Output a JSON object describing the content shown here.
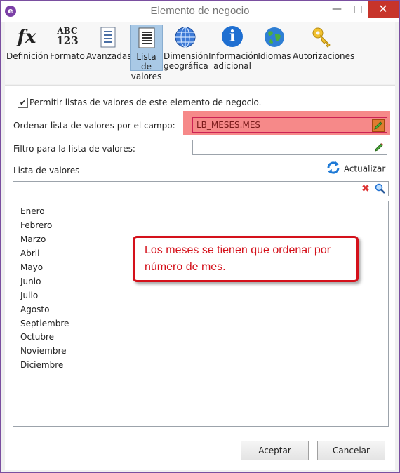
{
  "window": {
    "title": "Elemento de negocio",
    "minimize": "—",
    "maximize": "□",
    "close": "✕",
    "app_icon": "e"
  },
  "ribbon": {
    "items": [
      {
        "label": "Definición",
        "icon": "fx-icon",
        "glyph": "fx"
      },
      {
        "label": "Formato",
        "icon": "abc-123-icon",
        "glyph_top": "ABC",
        "glyph_bottom": "123"
      },
      {
        "label": "Avanzadas",
        "icon": "document-list-icon"
      },
      {
        "label_line1": "Lista de",
        "label_line2": "valores",
        "icon": "list-icon",
        "active": true
      },
      {
        "label_line1": "Dimensión",
        "label_line2": "geográfica",
        "icon": "globe-grid-icon"
      },
      {
        "label_line1": "Información",
        "label_line2": "adicional",
        "icon": "info-icon",
        "glyph": "i"
      },
      {
        "label": "Idiomas",
        "icon": "globe-icon"
      },
      {
        "label": "Autorizaciones",
        "icon": "key-icon"
      }
    ]
  },
  "form": {
    "checkbox_label": "Permitir listas de valores de este elemento de negocio.",
    "checkbox_checked": true,
    "check_mark": "✔",
    "order_label": "Ordenar lista de valores por el campo:",
    "order_value": "LB_MESES.MES",
    "filter_label": "Filtro para la lista de valores:",
    "filter_value": "",
    "list_label": "Lista de valores",
    "refresh_label": "Actualizar",
    "search_value": ""
  },
  "values": [
    "Enero",
    "Febrero",
    "Marzo",
    "Abril",
    "Mayo",
    "Junio",
    "Julio",
    "Agosto",
    "Septiembre",
    "Octubre",
    "Noviembre",
    "Diciembre"
  ],
  "callout": {
    "text": "Los meses se tienen que ordenar por número de mes.",
    "color": "#d4111b"
  },
  "buttons": {
    "ok": "Aceptar",
    "cancel": "Cancelar"
  },
  "colors": {
    "accent": "#7b3fa6",
    "highlight": "#f47474",
    "active_tab": "#a9c9e6",
    "close": "#c7342a"
  }
}
